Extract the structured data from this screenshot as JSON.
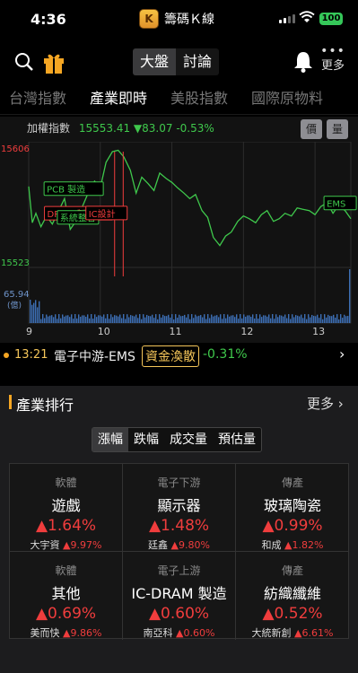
{
  "status": {
    "time": "4:36",
    "app_logo": "K",
    "app_name": "籌碼Ｋ線",
    "battery": "100"
  },
  "topbar": {
    "segments": [
      "大盤",
      "討論"
    ],
    "more_label": "更多",
    "more_dots": "•••"
  },
  "tabs": [
    "台灣指數",
    "產業即時",
    "美股指數",
    "國際原物料"
  ],
  "index": {
    "label": "加權指數",
    "value": "15553.41 ▼83.07 -0.53%",
    "toggle_price": "價",
    "toggle_volume": "量"
  },
  "chart_data": {
    "type": "line",
    "ylim": [
      15523,
      15606
    ],
    "y_high_label": "15606",
    "y_low_label": "15523",
    "volume_label": "65.94",
    "volume_unit": "(億)",
    "x_ticks": [
      "9",
      "10",
      "11",
      "12",
      "13"
    ],
    "annotations": [
      "PCB 製造",
      "DRAM 製造",
      "系統整合",
      "IC設計",
      "EMS"
    ],
    "series": [
      {
        "color": "#3fc84c",
        "x": [
          9.0,
          9.05,
          9.1,
          9.17,
          9.25,
          9.33,
          9.42,
          9.5,
          9.58,
          9.67,
          9.75,
          9.83,
          9.92,
          10.0,
          10.08,
          10.17,
          10.25,
          10.33,
          10.42,
          10.5,
          10.58,
          10.67,
          10.75,
          10.83,
          10.92,
          11.0,
          11.08,
          11.17,
          11.25,
          11.33,
          11.42,
          11.5,
          11.58,
          11.67,
          11.75,
          11.83,
          11.92,
          12.0,
          12.08,
          12.17,
          12.25,
          12.33,
          12.42,
          12.5,
          12.58,
          12.67,
          12.75,
          12.83,
          12.92,
          13.0,
          13.08,
          13.17,
          13.25,
          13.33,
          13.42,
          13.5
        ],
        "values": [
          15578,
          15551,
          15558,
          15548,
          15556,
          15550,
          15560,
          15569,
          15546,
          15553,
          15563,
          15573,
          15582,
          15577,
          15596,
          15604,
          15605,
          15600,
          15590,
          15573,
          15585,
          15580,
          15575,
          15588,
          15584,
          15581,
          15577,
          15573,
          15569,
          15572,
          15560,
          15555,
          15540,
          15534,
          15541,
          15544,
          15552,
          15556,
          15554,
          15551,
          15557,
          15560,
          15552,
          15554,
          15558,
          15556,
          15562,
          15561,
          15560,
          15557,
          15563,
          15566,
          15558,
          15564,
          15560,
          15554
        ]
      }
    ]
  },
  "news": {
    "time": "13:21",
    "text": "電子中游-EMS",
    "tag": "資金渙散",
    "change": "-0.31%"
  },
  "ranking": {
    "title": "產業排行",
    "more": "更多",
    "sort_tabs": [
      "漲幅",
      "跌幅",
      "成交量",
      "預估量"
    ],
    "cells": [
      {
        "category": "軟體",
        "name": "遊戲",
        "pct": "▲1.64%",
        "stock": "大宇資",
        "stock_pct": "▲9.97%"
      },
      {
        "category": "電子下游",
        "name": "顯示器",
        "pct": "▲1.48%",
        "stock": "廷鑫",
        "stock_pct": "▲9.80%"
      },
      {
        "category": "傳產",
        "name": "玻璃陶瓷",
        "pct": "▲0.99%",
        "stock": "和成",
        "stock_pct": "▲1.82%"
      },
      {
        "category": "軟體",
        "name": "其他",
        "pct": "▲0.69%",
        "stock": "美而快",
        "stock_pct": "▲9.86%"
      },
      {
        "category": "電子上游",
        "name": "IC-DRAM 製造",
        "pct": "▲0.60%",
        "stock": "南亞科",
        "stock_pct": "▲0.60%"
      },
      {
        "category": "傳產",
        "name": "紡織纖維",
        "pct": "▲0.52%",
        "stock": "大統新創",
        "stock_pct": "▲6.61%"
      }
    ]
  }
}
